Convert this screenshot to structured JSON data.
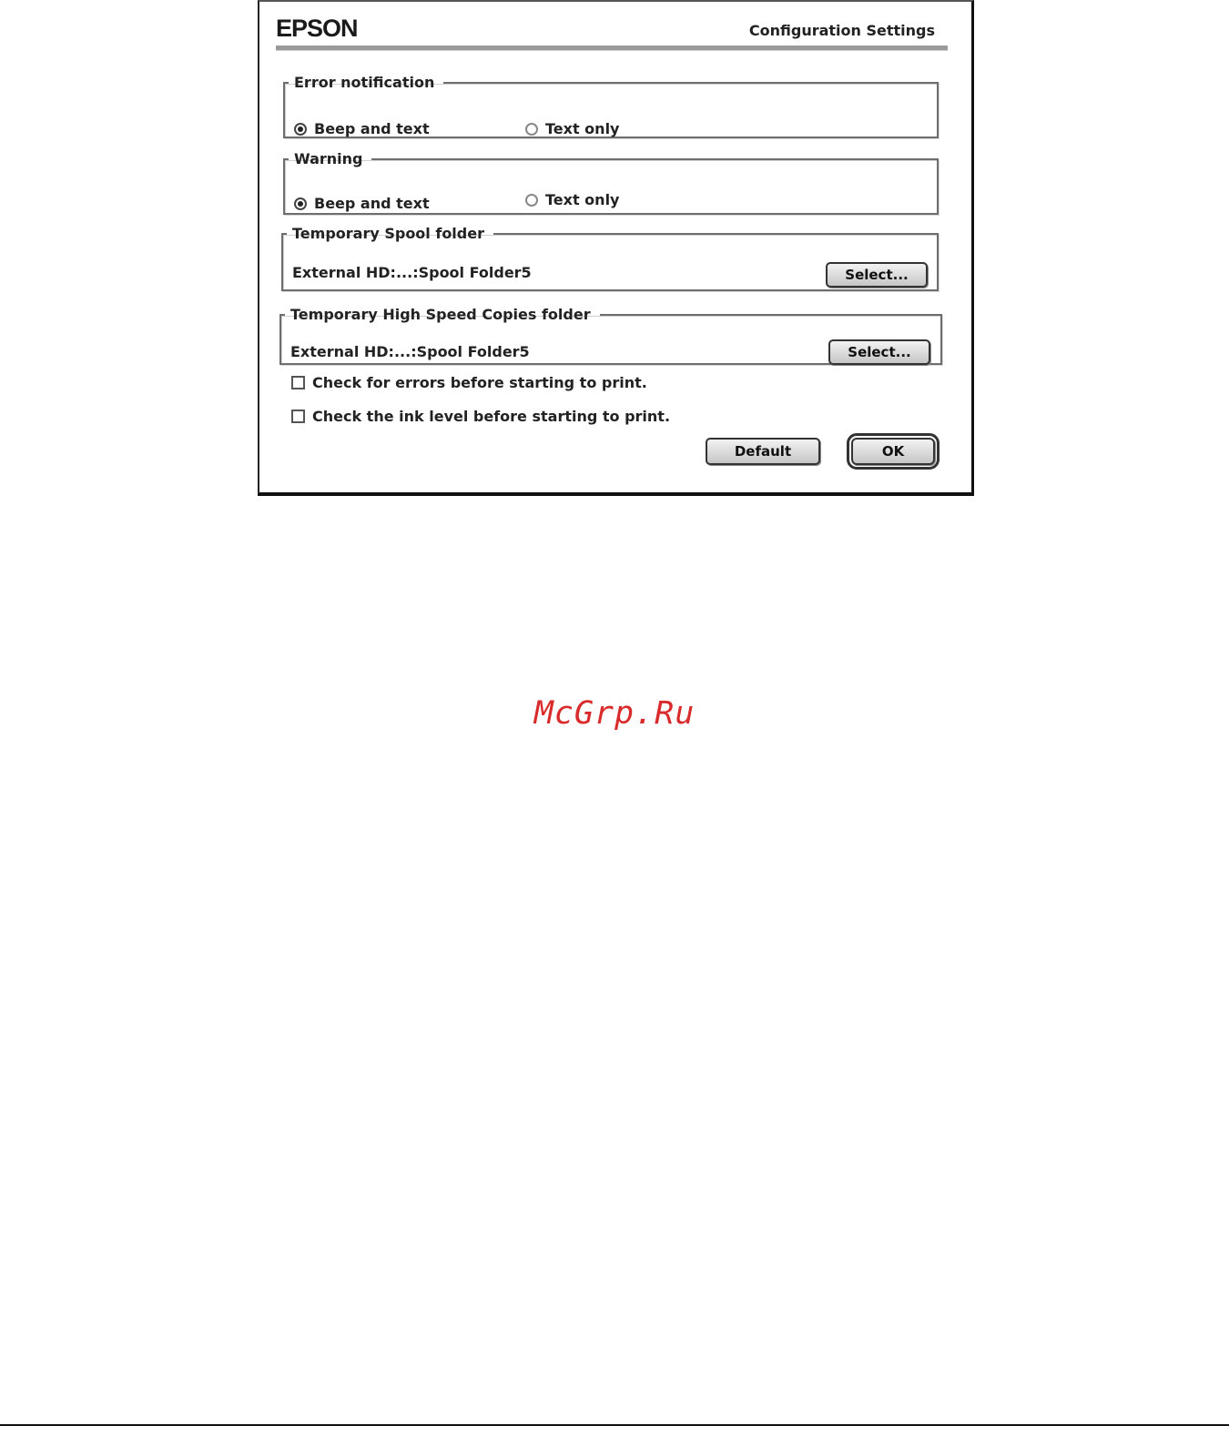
{
  "dialog": {
    "logo": "EPSON",
    "title": "Configuration Settings"
  },
  "error_notification": {
    "legend": "Error notification",
    "options": [
      "Beep and text",
      "Text only"
    ],
    "selected": "Beep and text"
  },
  "warning": {
    "legend": "Warning",
    "options": [
      "Beep and text",
      "Text only"
    ],
    "selected": "Beep and text"
  },
  "spool_folder": {
    "legend": "Temporary Spool folder",
    "path": "External HD:...:Spool Folder5",
    "button": "Select..."
  },
  "copies_folder": {
    "legend": "Temporary High Speed Copies folder",
    "path": "External HD:...:Spool Folder5",
    "button": "Select..."
  },
  "checks": [
    {
      "label": "Check for errors before starting to print.",
      "checked": false
    },
    {
      "label": "Check the ink level before starting to print.",
      "checked": false
    }
  ],
  "buttons": {
    "default": "Default",
    "ok": "OK"
  },
  "watermark": "McGrp.Ru"
}
